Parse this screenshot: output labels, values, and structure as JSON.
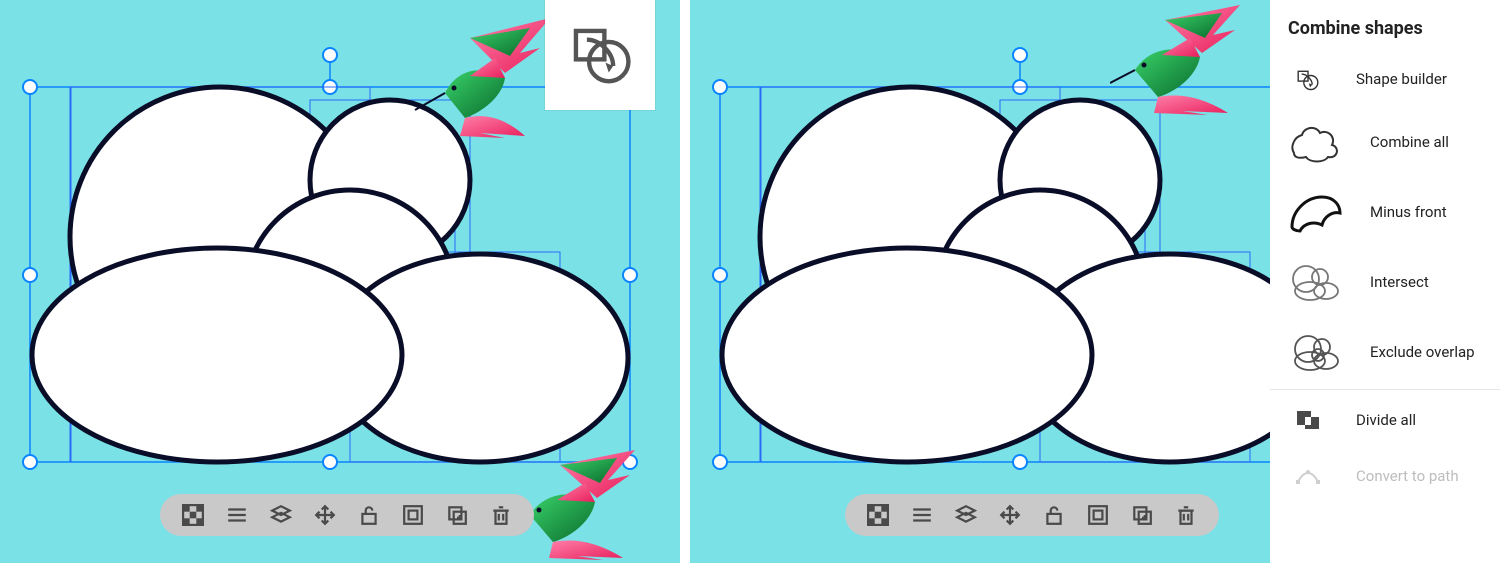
{
  "colors": {
    "canvas_bg": "#7ae1e6",
    "selection": "#0a84ff",
    "ellipse_fill": "#ffffff",
    "ellipse_stroke": "#0a0d27",
    "context_toolbar_bg": "#c9c9c9",
    "panel_bg": "#ffffff",
    "bird_pink": "#ff4f86",
    "bird_green": "#1b9c3f"
  },
  "combine_panel": {
    "title": "Combine shapes",
    "items": [
      {
        "id": "shape-builder",
        "label": "Shape builder"
      },
      {
        "id": "combine-all",
        "label": "Combine all"
      },
      {
        "id": "minus-front",
        "label": "Minus front"
      },
      {
        "id": "intersect",
        "label": "Intersect"
      },
      {
        "id": "exclude-overlap",
        "label": "Exclude overlap"
      },
      {
        "id": "divide-all",
        "label": "Divide all"
      },
      {
        "id": "convert-to-path",
        "label": "Convert to path",
        "disabled": true
      }
    ]
  },
  "context_toolbar": {
    "items": [
      "transparency-grid",
      "stroke-options",
      "arrange-layers",
      "move",
      "unlock",
      "group",
      "duplicate",
      "delete"
    ]
  },
  "floating_tool": {
    "name": "shape-builder-tool"
  }
}
